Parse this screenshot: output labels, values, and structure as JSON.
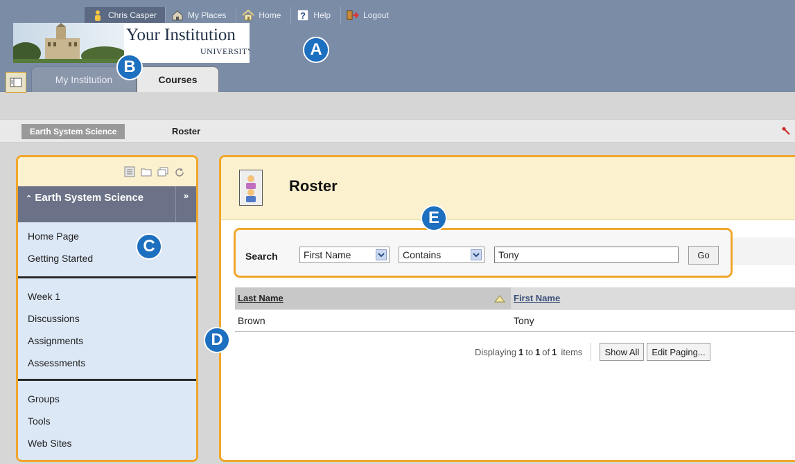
{
  "header": {
    "user": "Chris Casper",
    "my_places": "My Places",
    "home": "Home",
    "help": "Help",
    "logout": "Logout",
    "logo_title": "Your Institution",
    "logo_sub": "UNIVERSITY"
  },
  "tabs": [
    {
      "label": "My Institution"
    },
    {
      "label": "Courses"
    }
  ],
  "breadcrumb": {
    "course": "Earth System Science",
    "current": "Roster"
  },
  "course_menu": {
    "title": "Earth System Science",
    "expand_glyph": "»",
    "collapse_glyph": "«",
    "groups": [
      [
        "Home Page",
        "Getting Started"
      ],
      [
        "Week 1",
        "Discussions",
        "Assignments",
        "Assessments"
      ],
      [
        "Groups",
        "Tools",
        "Web Sites"
      ]
    ]
  },
  "content": {
    "title": "Roster",
    "search": {
      "label": "Search",
      "field": "First Name",
      "operator": "Contains",
      "value": "Tony",
      "go": "Go"
    },
    "table": {
      "columns": [
        "Last Name",
        "First Name"
      ],
      "rows": [
        [
          "Brown",
          "Tony"
        ]
      ]
    },
    "paging": {
      "prefix": "Displaying",
      "from": "1",
      "to_word": "to",
      "to": "1",
      "of_word": "of",
      "total": "1",
      "suffix": "items",
      "show_all": "Show All",
      "edit_paging": "Edit Paging..."
    }
  },
  "callouts": [
    "A",
    "B",
    "C",
    "D",
    "E"
  ],
  "colors": {
    "header_bg": "#7b8ca6",
    "highlight_border": "#f0a62b",
    "callout_blue": "#1d6fbf",
    "panel_header": "#fbf1cf",
    "menu_bg": "#dde8f6"
  }
}
